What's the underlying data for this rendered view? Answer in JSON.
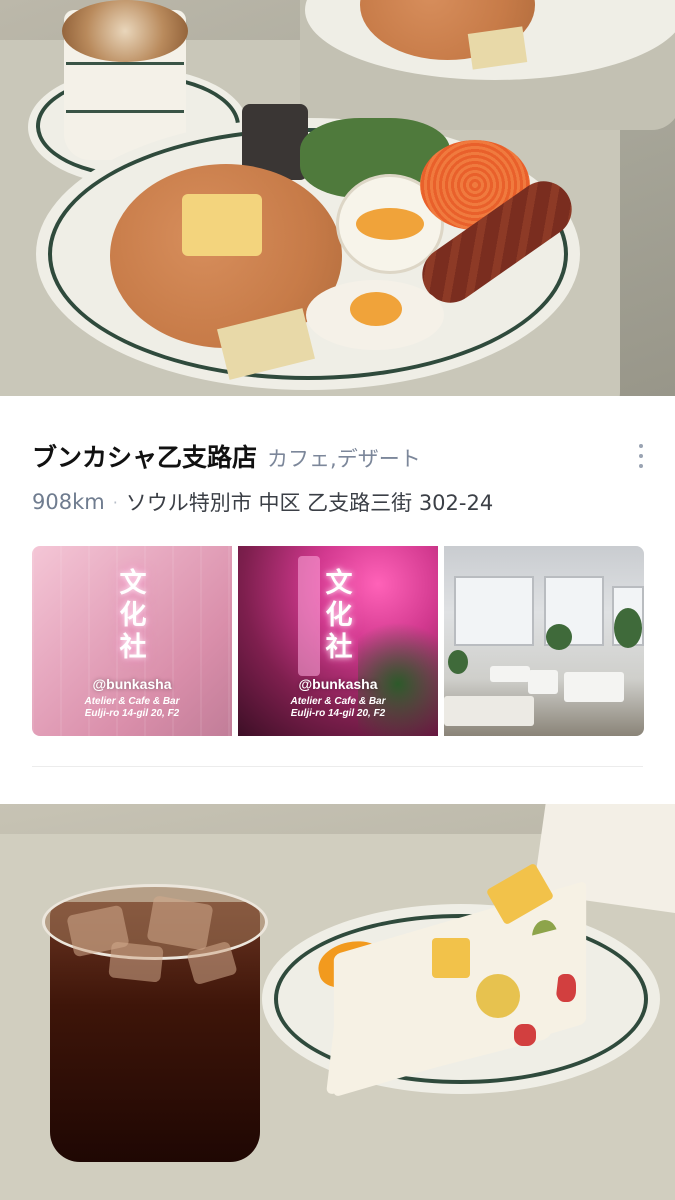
{
  "listing": {
    "name": "ブンカシャ乙支路店",
    "category": "カフェ,デザート",
    "distance": "908km",
    "separator": "·",
    "address": "ソウル特別市 中区 乙支路三街 302-24"
  },
  "photos": [
    {
      "neon_text": [
        "文",
        "化",
        "社"
      ],
      "handle": "@bunkasha",
      "tagline": "Atelier & Cafe & Bar",
      "address": "Eulji-ro 14-gil 20, F2"
    },
    {
      "neon_text": [
        "文",
        "化",
        "社"
      ],
      "handle": "@bunkasha",
      "tagline": "Atelier & Cafe & Bar",
      "address": "Eulji-ro 14-gil 20, F2"
    },
    {}
  ],
  "icons": {
    "more": "more-vertical-icon"
  },
  "colors": {
    "title": "#111111",
    "category": "#7c879a",
    "distance": "#6f7c8f",
    "address": "#3b3f46"
  }
}
